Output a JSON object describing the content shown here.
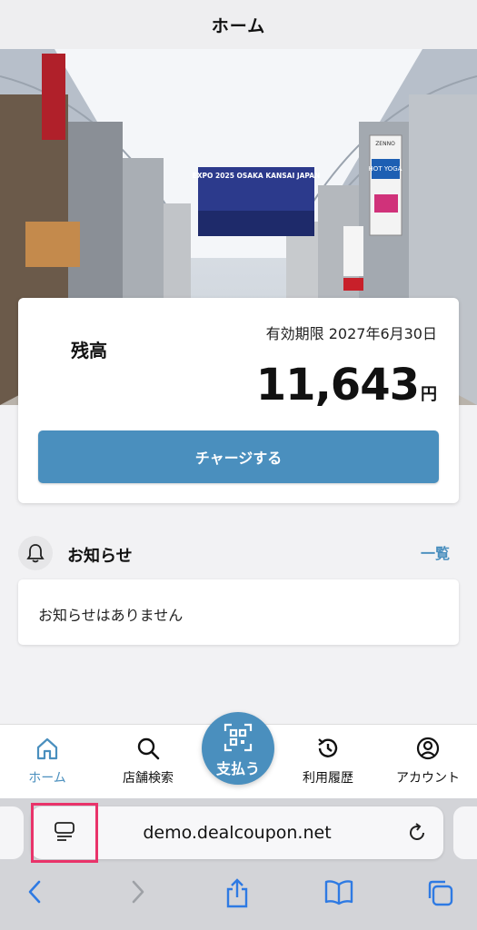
{
  "header": {
    "title": "ホーム"
  },
  "hero": {
    "banner_text": "EXPO 2025 OSAKA KANSAI JAPAN",
    "sign_hot_yoga": "HOT YOGA",
    "sign_zenno": "ZENNO"
  },
  "balance": {
    "label": "残高",
    "expiry": "有効期限 2027年6月30日",
    "amount": "11,643",
    "unit": "円",
    "charge_label": "チャージする"
  },
  "notice": {
    "title": "お知らせ",
    "all_label": "一覧",
    "empty_text": "お知らせはありません"
  },
  "tabbar": {
    "home": "ホーム",
    "search": "店舗検索",
    "pay": "支払う",
    "history": "利用履歴",
    "account": "アカウント"
  },
  "browser": {
    "url": "demo.dealcoupon.net"
  },
  "colors": {
    "accent": "#4a8fbe",
    "highlight": "#e9336a"
  }
}
